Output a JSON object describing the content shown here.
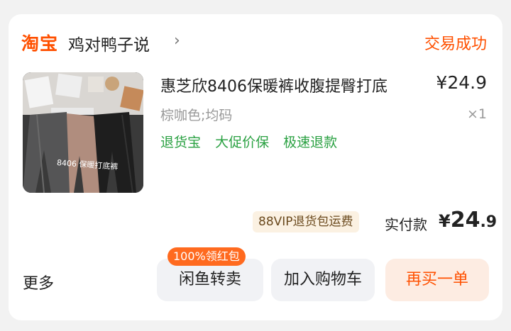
{
  "store": {
    "logo_text": "淘宝",
    "name": "鸡对鸭子说",
    "chevron": "›"
  },
  "order": {
    "status": "交易成功"
  },
  "product": {
    "title": "惠芝欣8406保暖裤收腹提臀打底",
    "price": "¥24.9",
    "spec": "棕咖色;均码",
    "quantity": "×1",
    "tags": [
      "退货宝",
      "大促价保",
      "极速退款"
    ],
    "image_caption": "8406 保暖打底裤"
  },
  "payment": {
    "vip_badge": "88VIP退货包运费",
    "paid_label": "实付款",
    "currency": "¥",
    "amount_int": "24",
    "amount_dec": ".9"
  },
  "actions": {
    "more": "更多",
    "resell": "闲鱼转卖",
    "resell_badge": "100%领红包",
    "add_to_cart": "加入购物车",
    "buy_again": "再买一单"
  },
  "colors": {
    "accent": "#ff5000",
    "tag_green": "#2aa142"
  }
}
